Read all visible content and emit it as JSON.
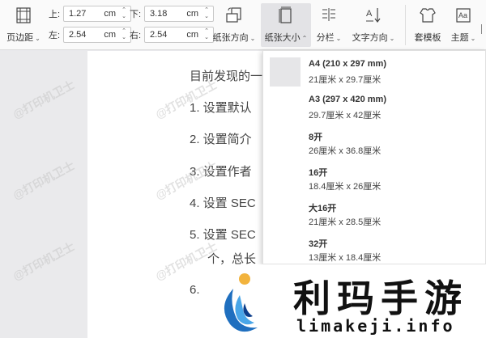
{
  "toolbar": {
    "margins_label": "页边距",
    "top_label": "上:",
    "top_value": "1.27",
    "bottom_label": "下:",
    "bottom_value": "3.18",
    "left_label": "左:",
    "left_value": "2.54",
    "right_label": "右:",
    "right_value": "2.54",
    "unit": "cm",
    "orientation_label": "纸张方向",
    "size_label": "纸张大小",
    "columns_label": "分栏",
    "text_direction_label": "文字方向",
    "template_label": "套模板",
    "theme_label": "主题"
  },
  "document": {
    "lines": [
      "目前发现的一",
      "1. 设置默认",
      "2. 设置简介",
      "3. 设置作者",
      "4. 设置 SEC",
      "5. 设置 SEC",
      "个，总长",
      "6."
    ],
    "watermark": "@打印机卫士"
  },
  "paper_sizes": [
    {
      "name": "A4 (210 x 297 mm)",
      "dims": "21厘米 x 29.7厘米"
    },
    {
      "name": "A3 (297 x 420 mm)",
      "dims": "29.7厘米 x 42厘米"
    },
    {
      "name": "8开",
      "dims": "26厘米 x 36.8厘米"
    },
    {
      "name": "16开",
      "dims": "18.4厘米 x 26厘米"
    },
    {
      "name": "大16开",
      "dims": "21厘米 x 28.5厘米"
    },
    {
      "name": "32开",
      "dims": "13厘米 x 18.4厘米"
    }
  ],
  "banner": {
    "brand_cn": "利玛手游",
    "brand_url": "limakeji.info"
  }
}
